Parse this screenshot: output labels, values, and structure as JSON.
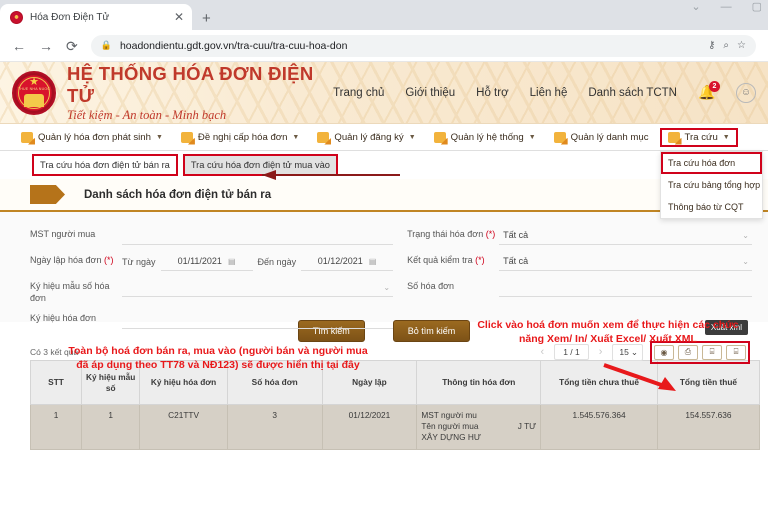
{
  "browser": {
    "tab_title": "Hóa Đơn Điện Tử",
    "tab_close": "✕",
    "new_tab": "+",
    "back": "←",
    "forward": "→",
    "reload": "⟳",
    "lock_icon": "🔒",
    "url": "hoadondientu.gdt.gov.vn/tra-cuu/tra-cuu-hoa-don",
    "key_icon": "⚷",
    "zoom_icon": "⌕",
    "star_icon": "☆",
    "win_minimize_group": "⌄",
    "win_minimize": "—",
    "win_maximize": "▢"
  },
  "header": {
    "emblem_text": "THUE NHA NUOC",
    "brand_line1": "HỆ THỐNG HÓA ĐƠN ĐIỆN TỬ",
    "brand_line2": "Tiết kiệm - An toàn - Minh bạch",
    "nav": [
      {
        "label": "Trang chủ"
      },
      {
        "label": "Giới thiệu"
      },
      {
        "label": "Hỗ trợ"
      },
      {
        "label": "Liên hệ"
      },
      {
        "label": "Danh sách TCTN"
      }
    ],
    "bell_glyph": "🔔",
    "notification_count": "2",
    "avatar_glyph": "☺"
  },
  "menubar": {
    "items": [
      {
        "label": "Quản lý hóa đơn phát sinh",
        "caret": "▼",
        "highlighted": false
      },
      {
        "label": "Đề nghị cấp hóa đơn",
        "caret": "▼",
        "highlighted": false
      },
      {
        "label": "Quản lý đăng ký",
        "caret": "▼",
        "highlighted": false
      },
      {
        "label": "Quản lý hệ thống",
        "caret": "▼",
        "highlighted": false
      },
      {
        "label": "Quản lý danh mục",
        "caret": "",
        "highlighted": false
      },
      {
        "label": "Tra cứu",
        "caret": "▼",
        "highlighted": true
      }
    ],
    "dropdown": [
      {
        "label": "Tra cứu hóa đơn",
        "highlighted": true
      },
      {
        "label": "Tra cứu bảng tổng hợp",
        "highlighted": false
      },
      {
        "label": "Thông báo từ CQT",
        "highlighted": false
      }
    ]
  },
  "subtabs": [
    {
      "label": "Tra cứu hóa đơn điện tử bán ra",
      "active": false
    },
    {
      "label": "Tra cứu hóa đơn điện tử mua vào",
      "active": true
    }
  ],
  "panel": {
    "title": "Danh sách hóa đơn điện tử bán ra"
  },
  "form": {
    "left": {
      "mst_label": "MST người mua",
      "date_label": "Ngày lập hóa đơn",
      "date_required": "(*)",
      "from_label": "Từ ngày",
      "from_value": "01/11/2021",
      "to_label": "Đến ngày",
      "to_value": "01/12/2021",
      "mau_so_label": "Ký hiệu mẫu số hóa đơn",
      "ky_hieu_label": "Ký hiệu hóa đơn"
    },
    "right": {
      "trang_thai_label": "Trạng thái hóa đơn",
      "trang_thai_required": "(*)",
      "trang_thai_value": "Tất cả",
      "ket_qua_label": "Kết quả kiểm tra",
      "ket_qua_required": "(*)",
      "ket_qua_value": "Tất cả",
      "so_hoa_don_label": "Số hóa đơn"
    },
    "search_button": "Tìm kiếm",
    "clear_button": "Bỏ tìm kiếm",
    "caret_glyph": "⌄",
    "calendar_glyph": "▤"
  },
  "results": {
    "count_text": "Có 3 kết quả",
    "prev": "‹",
    "page": "1 / 1",
    "next": "›",
    "page_size": "15",
    "page_size_caret": "⌄",
    "actions": [
      {
        "name": "view",
        "glyph": "◉"
      },
      {
        "name": "print",
        "glyph": "⎙"
      },
      {
        "name": "export-excel",
        "glyph": "⌸"
      },
      {
        "name": "export-xml",
        "glyph": "⌸"
      }
    ],
    "tooltip": "Xuất xml"
  },
  "table": {
    "columns": [
      "STT",
      "Ký hiệu mẫu số",
      "Ký hiệu hóa đơn",
      "Số hóa đơn",
      "Ngày lập",
      "Thông tin hóa đơn",
      "Tổng tiền chưa thuế",
      "Tổng tiền thuế"
    ],
    "rows": [
      {
        "stt": "1",
        "mau_so": "1",
        "ky_hieu": "C21TTV",
        "so_hoa_don": "3",
        "ngay_lap": "01/12/2021",
        "info_line1": "MST người mu",
        "info_line2": "Tên người mua",
        "info_line2_tail": "J TƯ",
        "info_line3": "XÂY DỰNG HƯ",
        "tien_chua_thue": "1.545.576.364",
        "tien_thue": "154.557.636"
      }
    ]
  },
  "annotations": {
    "left": "Toàn bộ hoá đơn bán ra, mua vào (người bán và người mua đã áp dụng theo TT78 và NĐ123) sẽ được hiển thị tại đây",
    "right": "Click vào hoá đơn muốn xem để thực hiện các chức năng Xem/ In/ Xuất Excel/ Xuất XML"
  }
}
